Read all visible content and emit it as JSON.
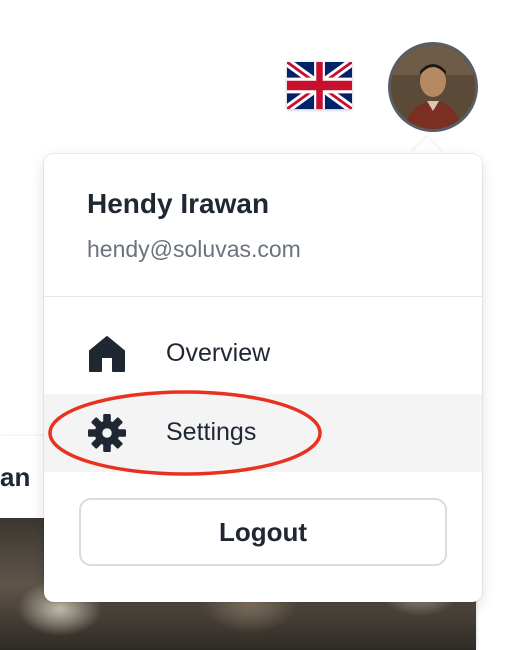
{
  "background": {
    "card_title_fragment": "an"
  },
  "topbar": {
    "language_flag_icon": "uk-flag-icon",
    "avatar_icon": "user-avatar"
  },
  "dropdown": {
    "user_name": "Hendy Irawan",
    "user_email": "hendy@soluvas.com",
    "menu": [
      {
        "label": "Overview",
        "icon": "home-icon"
      },
      {
        "label": "Settings",
        "icon": "gear-icon"
      }
    ],
    "logout_label": "Logout"
  },
  "colors": {
    "text": "#1f2733",
    "muted": "#6b7280",
    "highlight_bg": "#f4f4f5",
    "annotation": "#e8321f",
    "flag_blue": "#012169",
    "flag_red": "#c8102e"
  }
}
